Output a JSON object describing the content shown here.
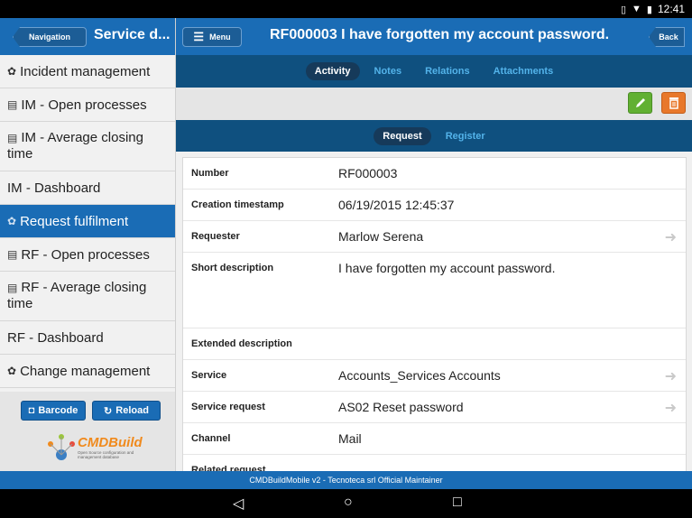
{
  "status_bar": {
    "time": "12:41",
    "icons": [
      "vibrate-icon",
      "wifi-icon",
      "battery-icon"
    ]
  },
  "sidebar": {
    "nav_button": "Navigation",
    "title": "Service d...",
    "items": [
      {
        "label": "Incident management",
        "icon": "gear-icon",
        "active": false
      },
      {
        "label": "IM - Open processes",
        "icon": "card-icon",
        "active": false
      },
      {
        "label": "IM - Average closing time",
        "icon": "card-icon",
        "active": false
      },
      {
        "label": "IM - Dashboard",
        "icon": "",
        "active": false
      },
      {
        "label": "Request fulfilment",
        "icon": "gear-icon",
        "active": true
      },
      {
        "label": "RF - Open processes",
        "icon": "card-icon",
        "active": false
      },
      {
        "label": "RF - Average closing time",
        "icon": "card-icon",
        "active": false
      },
      {
        "label": "RF - Dashboard",
        "icon": "",
        "active": false
      },
      {
        "label": "Change management",
        "icon": "gear-icon",
        "active": false
      }
    ],
    "barcode_button": "Barcode",
    "reload_button": "Reload",
    "logo_text": "CMDBuild",
    "logo_subtext": "Open Source configuration and management database"
  },
  "header": {
    "menu_button": "Menu",
    "title": "RF000003 I have forgotten my account password.",
    "back_button": "Back"
  },
  "tabs": [
    {
      "label": "Activity",
      "active": true
    },
    {
      "label": "Notes",
      "active": false
    },
    {
      "label": "Relations",
      "active": false
    },
    {
      "label": "Attachments",
      "active": false
    }
  ],
  "subtabs": [
    {
      "label": "Request",
      "active": true
    },
    {
      "label": "Register",
      "active": false
    }
  ],
  "fields": [
    {
      "label": "Number",
      "value": "RF000003",
      "link": false
    },
    {
      "label": "Creation timestamp",
      "value": "06/19/2015 12:45:37",
      "link": false
    },
    {
      "label": "Requester",
      "value": "Marlow Serena",
      "link": true
    },
    {
      "label": "Short description",
      "value": "I have forgotten my account password.",
      "link": false
    },
    {
      "label": "Extended description",
      "value": "",
      "link": false
    },
    {
      "label": "Service",
      "value": "Accounts_Services Accounts",
      "link": true
    },
    {
      "label": "Service request",
      "value": "AS02 Reset password",
      "link": true
    },
    {
      "label": "Channel",
      "value": "Mail",
      "link": false
    },
    {
      "label": "Related request",
      "value": "",
      "link": false
    }
  ],
  "footer": "CMDBuildMobile v2 - Tecnoteca srl Official Maintainer",
  "colors": {
    "primary": "#1a6cb5",
    "dark_tab": "#0f507f",
    "edit": "#61b032",
    "delete": "#e8782b",
    "logo": "#f08a1d"
  }
}
